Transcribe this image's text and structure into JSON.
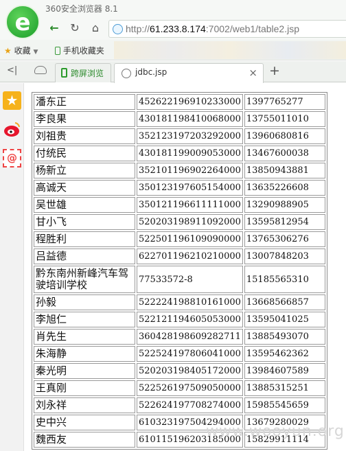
{
  "window": {
    "title": "360安全浏览器 8.1"
  },
  "navigation": {
    "back": "←",
    "reload": "↻",
    "home": "⌂"
  },
  "address_bar": {
    "url_prefix": "http://",
    "url_host": "61.233.8.174",
    "url_rest": ":7002/web1/table2.jsp"
  },
  "bookmarks": {
    "favorites_label": "收藏",
    "mobile_label": "手机收藏夹"
  },
  "tabs": [
    {
      "label": "跨屏浏览"
    },
    {
      "label": "jdbc.jsp",
      "close": "×"
    }
  ],
  "new_tab": "+",
  "table": {
    "rows": [
      {
        "name": "潘东正",
        "id": "452622196910233000",
        "phone": "1397765277"
      },
      {
        "name": "李良果",
        "id": "430181198410068000",
        "phone": "13755011010"
      },
      {
        "name": "刘祖贵",
        "id": "352123197203292000",
        "phone": "13960680816"
      },
      {
        "name": "付统民",
        "id": "430181199009053000",
        "phone": "13467600038"
      },
      {
        "name": "杨新立",
        "id": "352101196902264000",
        "phone": "13850943881"
      },
      {
        "name": "高诚天",
        "id": "350123197605154000",
        "phone": "13635226608"
      },
      {
        "name": "吴世雄",
        "id": "350121196611111000",
        "phone": "13290988905"
      },
      {
        "name": "甘小飞",
        "id": "520203198911092000",
        "phone": "13595812954"
      },
      {
        "name": "程胜利",
        "id": "522501196109090000",
        "phone": "13765306276"
      },
      {
        "name": "吕益德",
        "id": "622701196210210000",
        "phone": "13007848203"
      },
      {
        "name": "黔东南州新峰汽车驾驶培训学校",
        "id": "77533572-8",
        "phone": "15185565310"
      },
      {
        "name": "孙毅",
        "id": "522224198810161000",
        "phone": "13668566857"
      },
      {
        "name": "李旭仁",
        "id": "522121194605053000",
        "phone": "13595041025"
      },
      {
        "name": "肖先生",
        "id": "360428198609282711",
        "phone": "13885493070"
      },
      {
        "name": "朱海静",
        "id": "522524197806041000",
        "phone": "13595462362"
      },
      {
        "name": "秦光明",
        "id": "520203198405172000",
        "phone": "13984607589"
      },
      {
        "name": "王真刚",
        "id": "522526197509050000",
        "phone": "13885315251"
      },
      {
        "name": "刘永祥",
        "id": "522624197708274000",
        "phone": "15985545659"
      },
      {
        "name": "史中兴",
        "id": "610323197504294000",
        "phone": "13679280029"
      },
      {
        "name": "魏西友",
        "id": "610115196203185000",
        "phone": "15829911114"
      }
    ]
  },
  "watermark": "www.wooyun.org"
}
